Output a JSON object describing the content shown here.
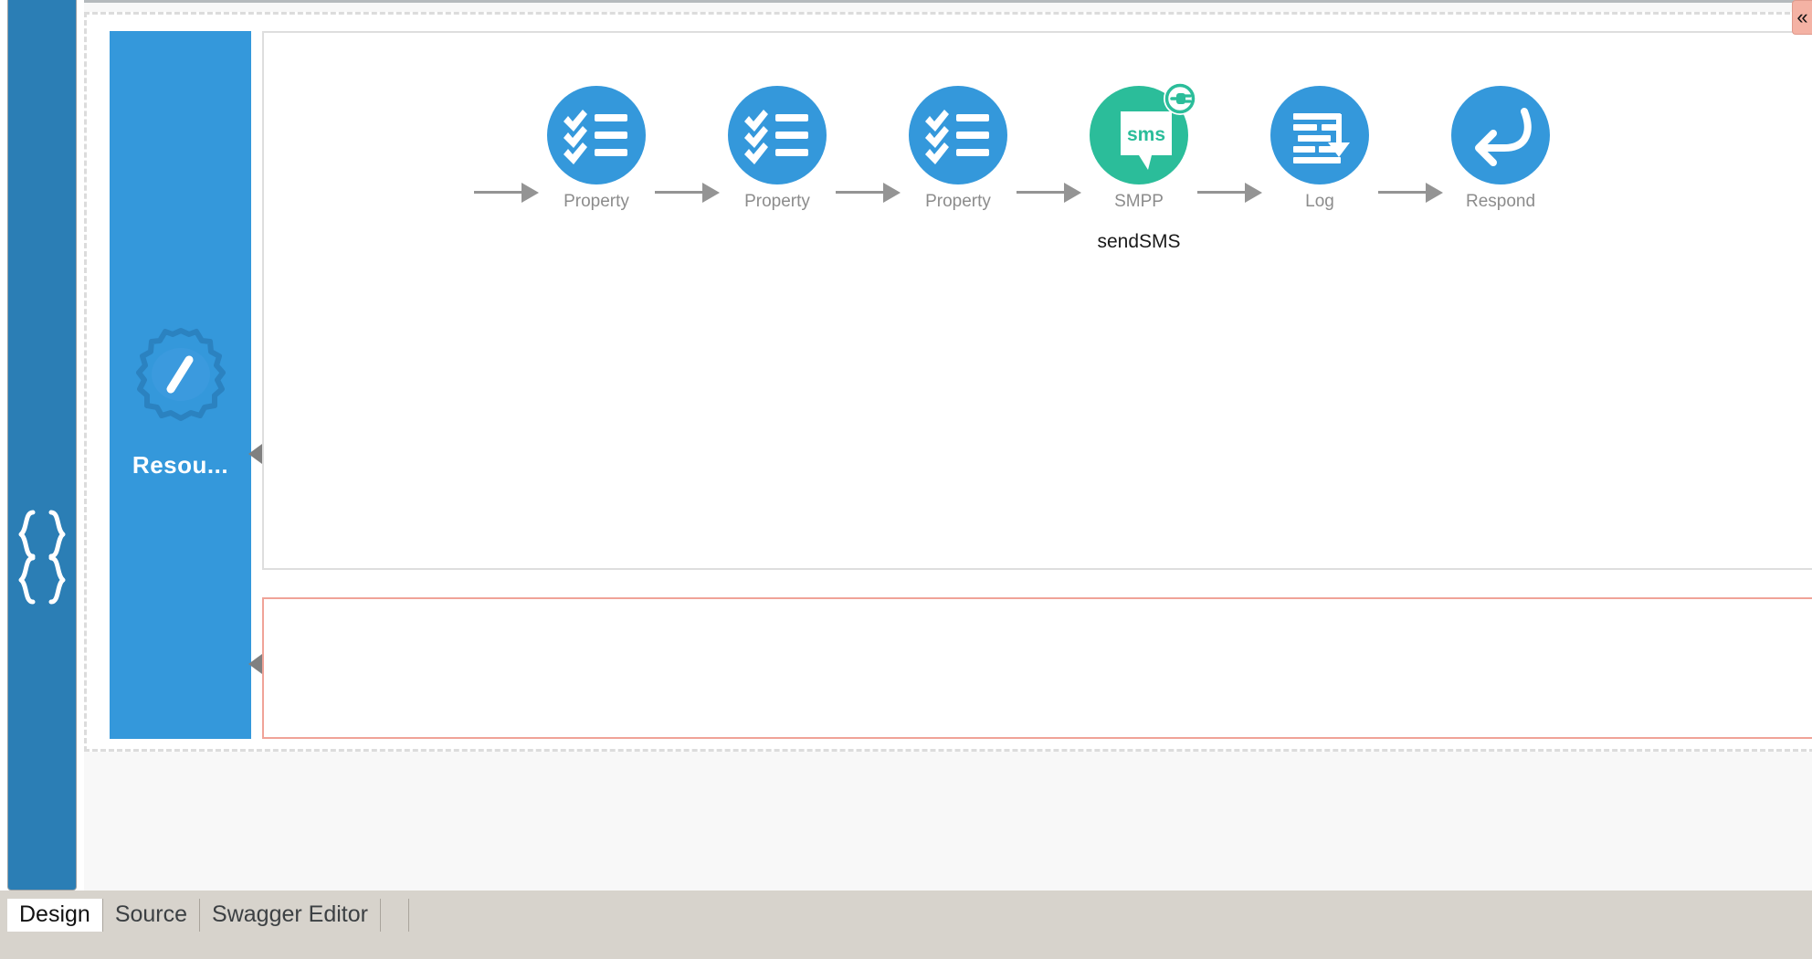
{
  "rail": {
    "label": "API"
  },
  "resource": {
    "label": "Resou...",
    "icon": "resource-gear-icon"
  },
  "sequences": {
    "in_sequence_name": "in-sequence-panel",
    "fault_sequence_name": "fault-sequence-panel"
  },
  "flow": {
    "nodes": [
      {
        "label": "Property",
        "name": "",
        "icon": "property-checklist-icon",
        "color": "#3498db"
      },
      {
        "label": "Property",
        "name": "",
        "icon": "property-checklist-icon",
        "color": "#3498db"
      },
      {
        "label": "Property",
        "name": "",
        "icon": "property-checklist-icon",
        "color": "#3498db"
      },
      {
        "label": "SMPP",
        "name": "sendSMS",
        "icon": "smpp-sms-icon",
        "color": "#2bbd9a"
      },
      {
        "label": "Log",
        "name": "",
        "icon": "log-icon",
        "color": "#3498db"
      },
      {
        "label": "Respond",
        "name": "",
        "icon": "respond-reply-arrow-icon",
        "color": "#3498db"
      }
    ],
    "sms_bubble_text": "sms"
  },
  "collapse": {
    "glyph": "«"
  },
  "tabs": [
    {
      "label": "Design",
      "active": true
    },
    {
      "label": "Source",
      "active": false
    },
    {
      "label": "Swagger Editor",
      "active": false
    }
  ],
  "colors": {
    "rail_blue": "#2b7eb5",
    "resource_blue": "#3498db",
    "node_blue": "#3498db",
    "smpp_green": "#2bbd9a",
    "fault_border": "#f0a398",
    "arrow_gray": "#949494",
    "label_gray": "#8c8c8c",
    "canvas_bg": "#f8f8f8",
    "tabstrip_bg": "#d7d3cc"
  }
}
